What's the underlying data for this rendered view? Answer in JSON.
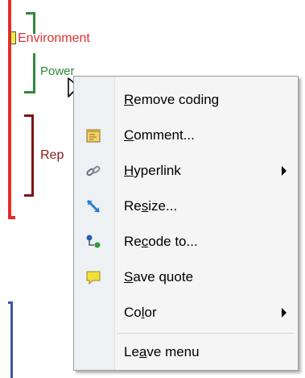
{
  "codes": [
    {
      "label": "Environment",
      "color": "#e03030"
    },
    {
      "label": "Power",
      "color": "#2e8b3a"
    },
    {
      "label": "Rep",
      "color": "#8b1a1a"
    }
  ],
  "menu": {
    "items": [
      {
        "pre": "",
        "u": "R",
        "post": "emove coding",
        "icon": "none",
        "submenu": false
      },
      {
        "pre": "",
        "u": "C",
        "post": "omment...",
        "icon": "comment-icon",
        "submenu": false
      },
      {
        "pre": "",
        "u": "H",
        "post": "yperlink",
        "icon": "hyperlink-icon",
        "submenu": true
      },
      {
        "pre": "Re",
        "u": "s",
        "post": "ize...",
        "icon": "resize-icon",
        "submenu": false
      },
      {
        "pre": "Re",
        "u": "c",
        "post": "ode to...",
        "icon": "recode-icon",
        "submenu": false
      },
      {
        "pre": "",
        "u": "S",
        "post": "ave quote",
        "icon": "save-quote-icon",
        "submenu": false
      },
      {
        "pre": "Co",
        "u": "l",
        "post": "or",
        "icon": "none",
        "submenu": true
      },
      {
        "pre": "Le",
        "u": "a",
        "post": "ve menu",
        "icon": "none",
        "submenu": false
      }
    ]
  }
}
